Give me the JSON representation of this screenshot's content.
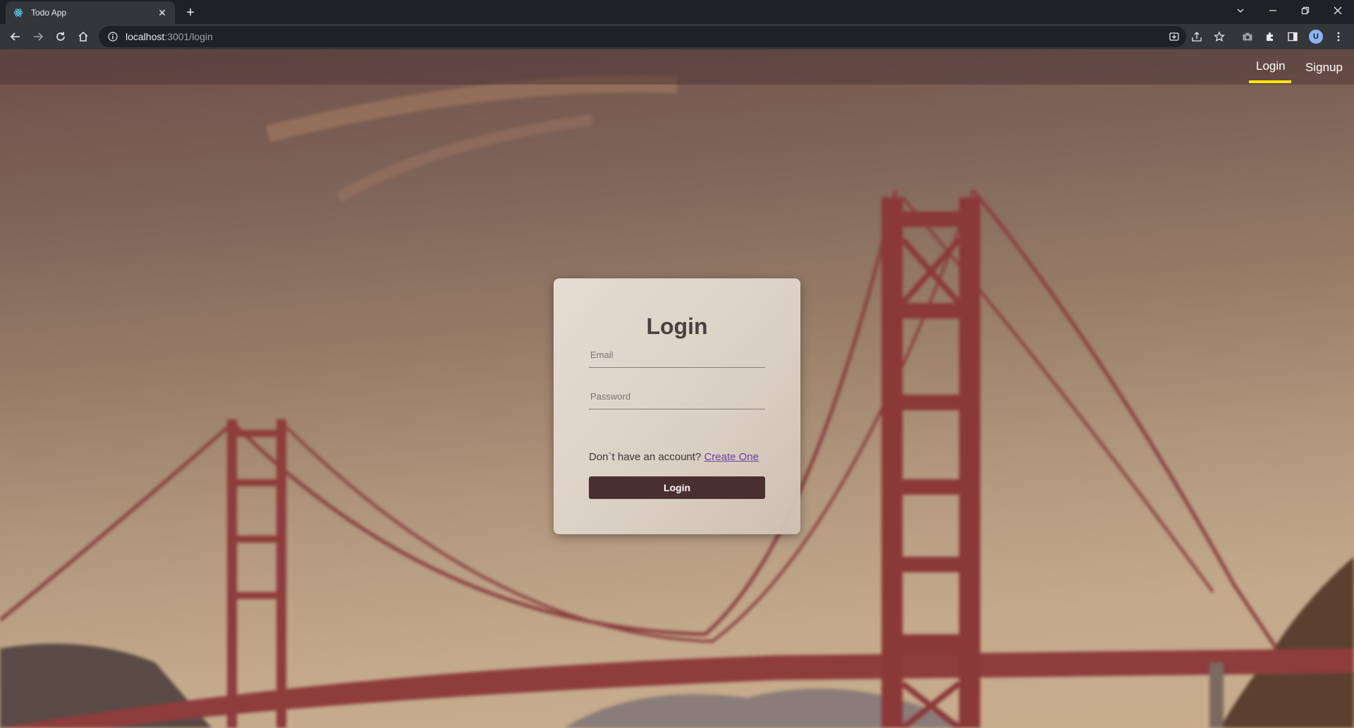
{
  "browser": {
    "tab_title": "Todo App",
    "url_host": "localhost",
    "url_path": ":3001/login",
    "avatar_letter": "U"
  },
  "navbar": {
    "links": [
      {
        "label": "Login",
        "active": true
      },
      {
        "label": "Signup",
        "active": false
      }
    ],
    "active_indicator_color": "#ffe600"
  },
  "login_form": {
    "title": "Login",
    "email_placeholder": "Email",
    "password_placeholder": "Password",
    "signup_prompt": "Don`t have an account?",
    "signup_link": "Create One",
    "submit_label": "Login"
  },
  "colors": {
    "button": "#4a2f31",
    "link": "#6b3fa0"
  }
}
